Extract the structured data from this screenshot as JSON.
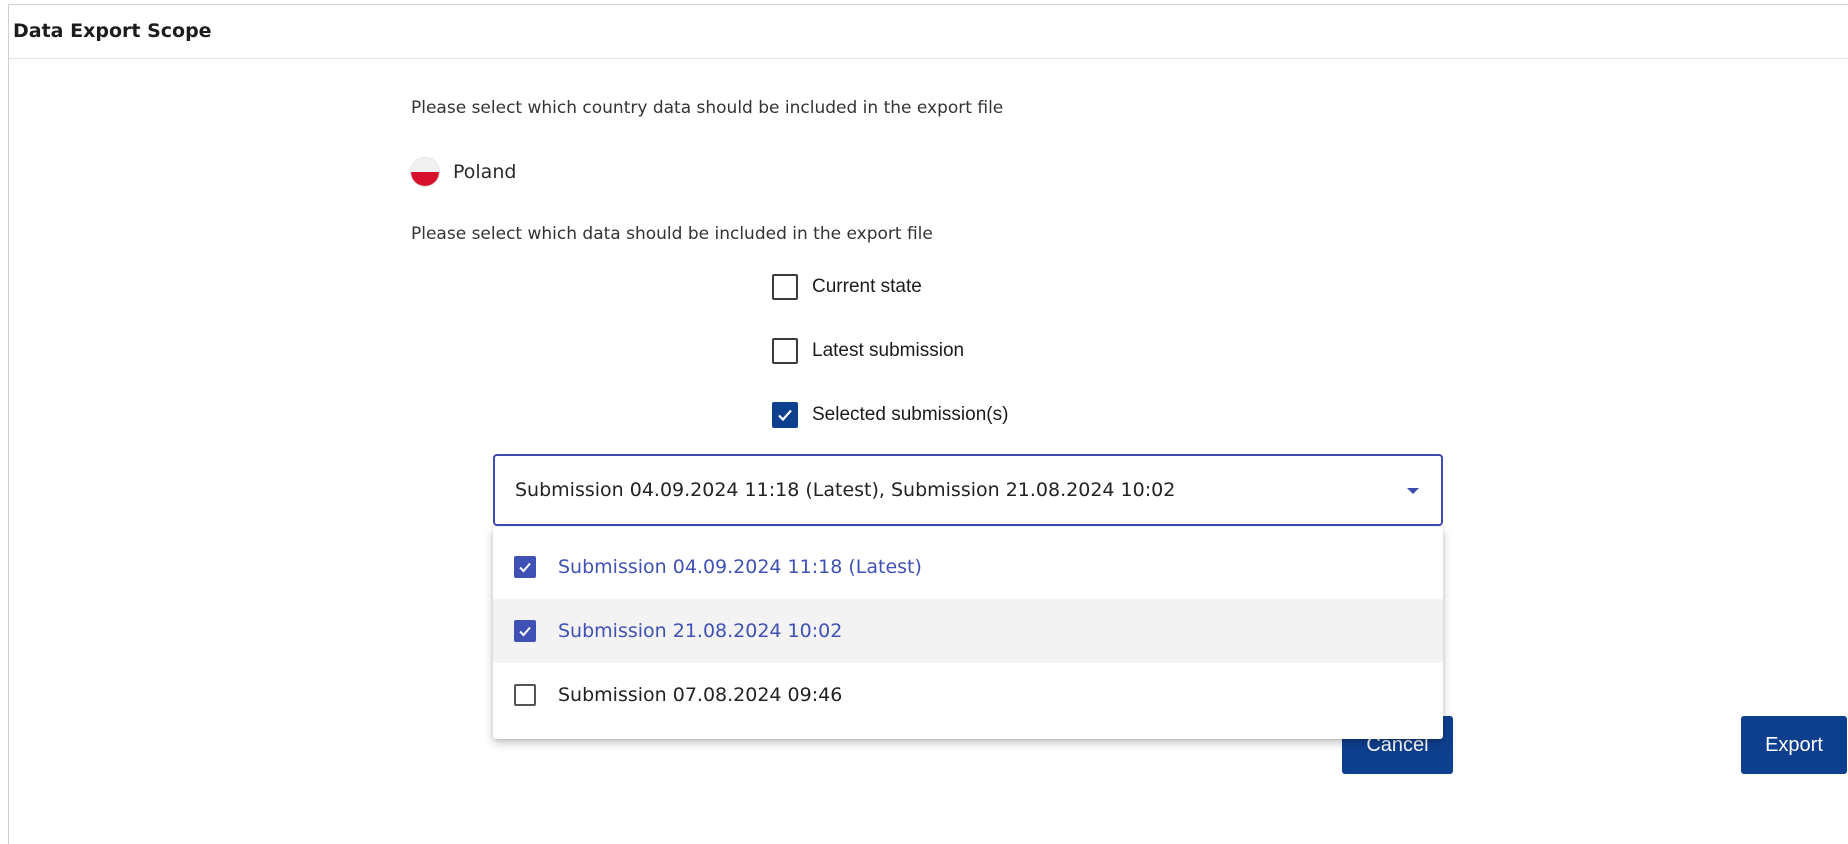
{
  "panel": {
    "title": "Data Export Scope"
  },
  "country_section": {
    "prompt": "Please select which country data should be included in the export file",
    "country": {
      "label": "Poland",
      "flag_icon": "poland-flag-icon"
    }
  },
  "data_section": {
    "prompt": "Please select which data should be included in the export file",
    "options": [
      {
        "label": "Current state",
        "checked": false
      },
      {
        "label": "Latest submission",
        "checked": false
      },
      {
        "label": "Selected submission(s)",
        "checked": true
      }
    ]
  },
  "submission_select": {
    "value": "Submission 04.09.2024 11:18 (Latest), Submission 21.08.2024 10:02",
    "caret_icon": "caret-down-icon",
    "options": [
      {
        "label": "Submission 04.09.2024 11:18 (Latest)",
        "checked": true
      },
      {
        "label": "Submission 21.08.2024 10:02",
        "checked": true
      },
      {
        "label": "Submission 07.08.2024 09:46",
        "checked": false
      }
    ]
  },
  "actions": {
    "cancel_label": "Cancel",
    "export_label": "Export"
  },
  "colors": {
    "primary_button": "#0e3f8f",
    "select_accent": "#3d4ab0",
    "dropdown_selected_text": "#3f51b5",
    "flag_red": "#d7102c"
  }
}
